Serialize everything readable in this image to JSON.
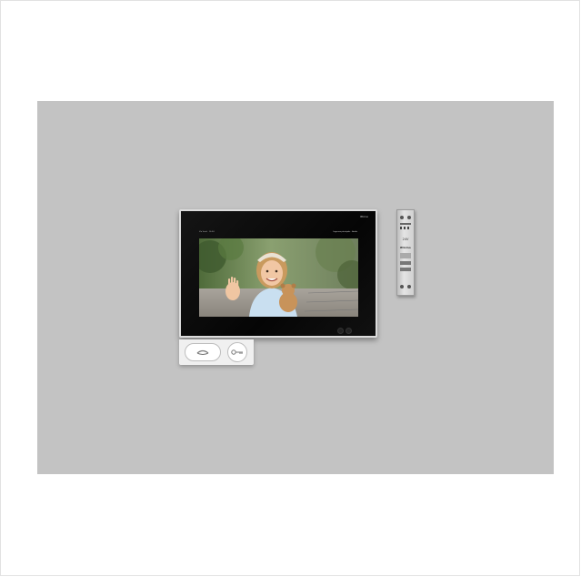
{
  "image": {
    "subject": "video-intercom-indoor-monitor",
    "background_color": "#c3c3c3"
  },
  "monitor": {
    "status_left": "Via Verdi · 10:34",
    "status_right": "Ingresso principale · Audio",
    "brand_mark": "Bticino",
    "video_subject": "child-waving-with-teddy-bear"
  },
  "buttons": {
    "talk_icon": "handset-icon",
    "door_icon": "key-icon"
  },
  "din_module": {
    "voltage_label": "24V",
    "brand_label": "Bticino"
  }
}
